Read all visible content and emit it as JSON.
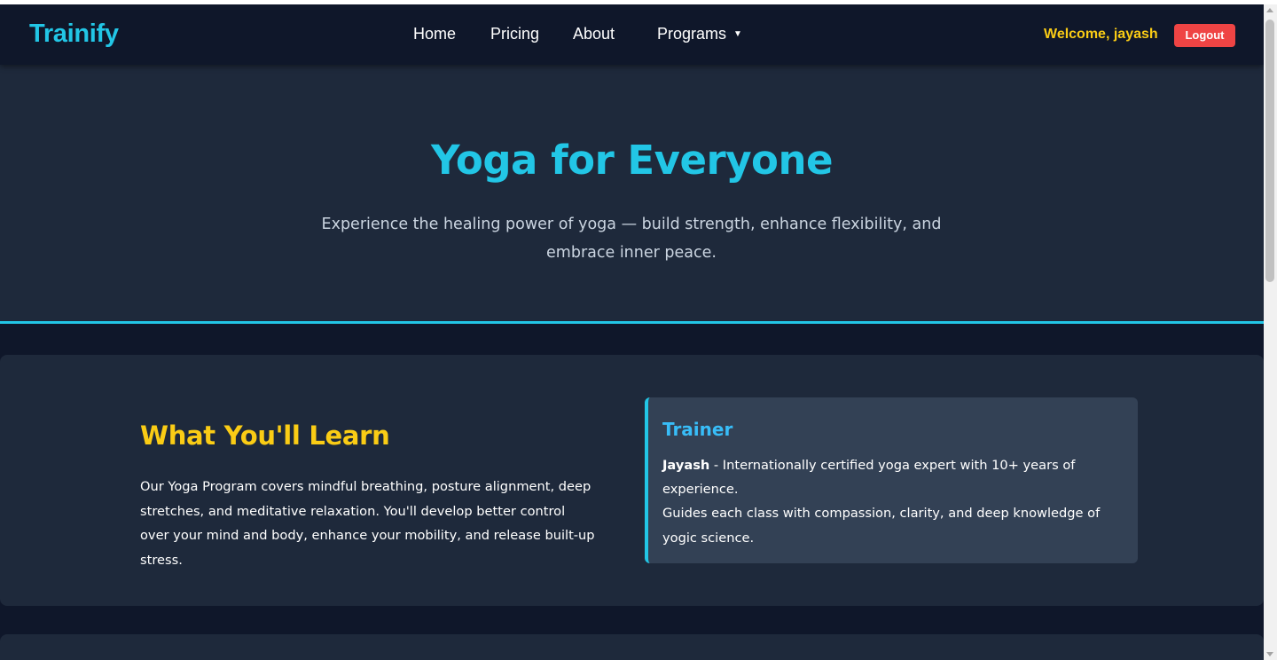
{
  "nav": {
    "brand": "Trainify",
    "links": [
      "Home",
      "Pricing",
      "About"
    ],
    "programs_label": "Programs",
    "programs_caret": "▼",
    "welcome": "Welcome, jayash",
    "logout_label": "Logout"
  },
  "hero": {
    "title": "Yoga for Everyone",
    "subtitle": "Experience the healing power of yoga — build strength, enhance flexibility, and embrace inner peace."
  },
  "learn": {
    "title": "What You'll Learn",
    "text": "Our Yoga Program covers mindful breathing, posture alignment, deep stretches, and meditative relaxation. You'll develop better control over your mind and body, enhance your mobility, and release built-up stress."
  },
  "trainer": {
    "title": "Trainer",
    "name": "Jayash",
    "description": " - Internationally certified yoga expert with 10+ years of experience.",
    "details": "Guides each class with compassion, clarity, and deep knowledge of yogic science."
  },
  "colors": {
    "accent": "#22c6e6",
    "highlight": "#facc15",
    "logout": "#ef4444",
    "background": "#0f172a",
    "card": "#1e293b"
  }
}
